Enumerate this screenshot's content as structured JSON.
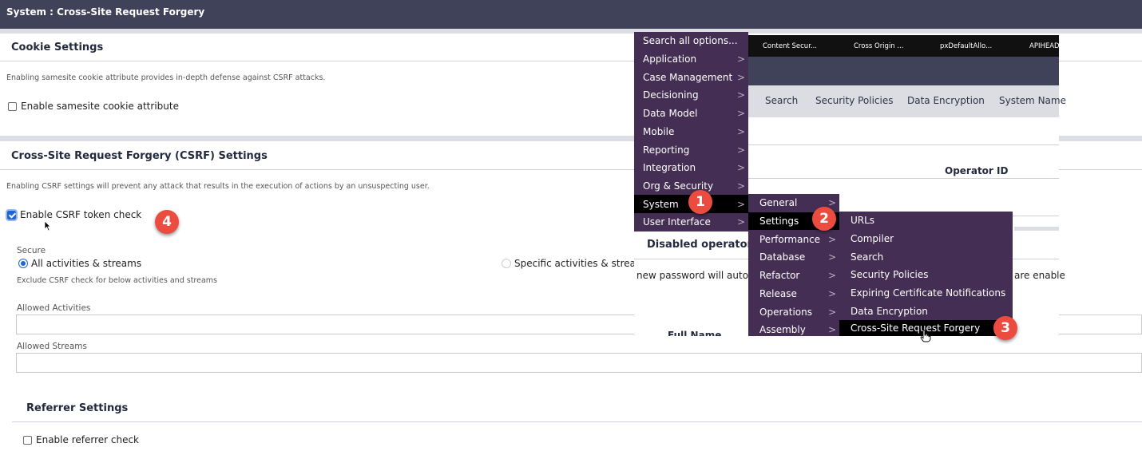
{
  "window": {
    "title": "System : Cross-Site Request Forgery"
  },
  "cookie_settings": {
    "heading": "Cookie Settings",
    "description": "Enabling samesite cookie attribute provides in-depth defense against CSRF attacks.",
    "checkbox_label": "Enable samesite cookie attribute",
    "checked": false
  },
  "csrf_settings": {
    "heading": "Cross-Site Request Forgery (CSRF) Settings",
    "description": "Enabling CSRF settings will prevent any attack that results in the execution of actions by an unsuspecting user.",
    "checkbox_label": "Enable CSRF token check",
    "checked": true,
    "secure_label": "Secure",
    "radio_options": [
      {
        "label": "All activities & streams",
        "selected": true
      },
      {
        "label": "Specific activities & stream",
        "selected": false
      }
    ],
    "exclude_note": "Exclude CSRF check for below activities and streams",
    "allowed_activities_label": "Allowed Activities",
    "allowed_activities_value": "",
    "allowed_streams_label": "Allowed Streams",
    "allowed_streams_value": ""
  },
  "referrer_settings": {
    "heading": "Referrer Settings",
    "checkbox_label": "Enable referrer check",
    "checked": false
  },
  "background": {
    "tabs": [
      "Content Secur...",
      "Cross Origin ...",
      "pxDefaultAllo...",
      "APIHEAD"
    ],
    "subnav": [
      "Search",
      "Security Policies",
      "Data Encryption",
      "System Name"
    ],
    "operator_id_header": "Operator ID",
    "disabled_operators_heading": "Disabled operators",
    "password_text_fragment": "new password will autom",
    "enabled_text_fragment": "are enable",
    "full_name_fragment": "Full Name"
  },
  "menu_level1": {
    "items": [
      {
        "label": "Search all options...",
        "has_submenu": false
      },
      {
        "label": "Application",
        "has_submenu": true
      },
      {
        "label": "Case Management",
        "has_submenu": true
      },
      {
        "label": "Decisioning",
        "has_submenu": true
      },
      {
        "label": "Data Model",
        "has_submenu": true
      },
      {
        "label": "Mobile",
        "has_submenu": true
      },
      {
        "label": "Reporting",
        "has_submenu": true
      },
      {
        "label": "Integration",
        "has_submenu": true
      },
      {
        "label": "Org & Security",
        "has_submenu": true
      },
      {
        "label": "System",
        "has_submenu": true,
        "active": true
      },
      {
        "label": "User Interface",
        "has_submenu": true
      }
    ]
  },
  "menu_level2": {
    "items": [
      {
        "label": "General",
        "has_submenu": true
      },
      {
        "label": "Settings",
        "has_submenu": true,
        "active": true
      },
      {
        "label": "Performance",
        "has_submenu": true
      },
      {
        "label": "Database",
        "has_submenu": true
      },
      {
        "label": "Refactor",
        "has_submenu": true
      },
      {
        "label": "Release",
        "has_submenu": true
      },
      {
        "label": "Operations",
        "has_submenu": true
      },
      {
        "label": "Assembly",
        "has_submenu": true
      }
    ]
  },
  "menu_level3": {
    "items": [
      {
        "label": "URLs"
      },
      {
        "label": "Compiler"
      },
      {
        "label": "Search"
      },
      {
        "label": "Security Policies"
      },
      {
        "label": "Expiring Certificate Notifications"
      },
      {
        "label": "Data Encryption"
      },
      {
        "label": "Cross-Site Request Forgery",
        "active": true
      }
    ]
  },
  "callouts": [
    "1",
    "2",
    "3",
    "4"
  ],
  "colors": {
    "titlebar": "#40425a",
    "menu_bg": "#452e53",
    "menu_active": "#000000",
    "callout": "#ec4c40",
    "checkbox_accent": "#1e66d6"
  }
}
